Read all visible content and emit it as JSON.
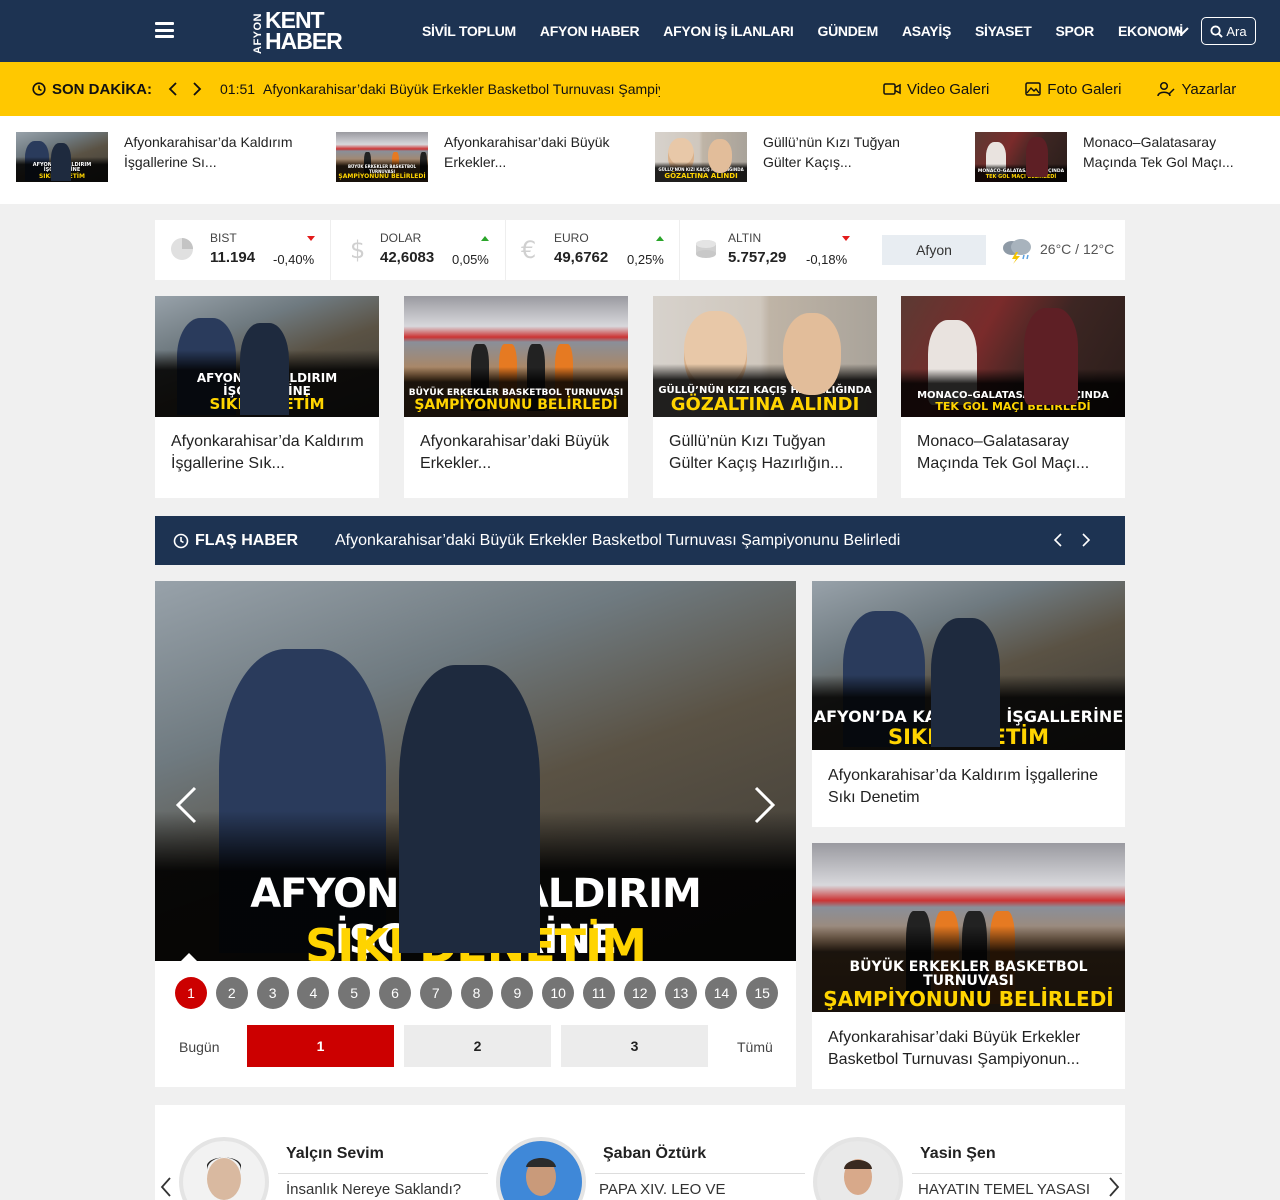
{
  "header": {
    "logo_side": "AFYON",
    "logo_top": "KENT",
    "logo_bottom": "HABER",
    "nav": [
      "SİVİL TOPLUM",
      "AFYON HABER",
      "AFYON İŞ İLANLARI",
      "GÜNDEM",
      "ASAYİŞ",
      "SİYASET",
      "SPOR",
      "EKONOMİ"
    ],
    "search_label": "Ara"
  },
  "breaking": {
    "label": "SON DAKİKA:",
    "time": "01:51",
    "text": "Afyonkarahisar’daki Büyük Erkekler Basketbol Turnuvası Şampiyonunu Belirledi",
    "links": [
      "Video Galeri",
      "Foto Galeri",
      "Yazarlar"
    ]
  },
  "strip": [
    {
      "title": "Afyonkarahisar’da Kaldırım İşgallerine Sı...",
      "cap1": "AFYON’DA KALDIRIM İŞGALLERİNE",
      "cap2": "SIKI DENETİM"
    },
    {
      "title": "Afyonkarahisar’daki Büyük Erkekler...",
      "cap1": "BÜYÜK ERKEKLER BASKETBOL TURNUVASI",
      "cap2": "ŞAMPİYONUNU BELİRLEDİ"
    },
    {
      "title": "Güllü’nün Kızı Tuğyan Gülter Kaçış...",
      "cap1": "GÜLLÜ’NÜN KIZI KAÇIŞ HAZIRLIĞINDA",
      "cap2": "GÖZALTINA ALINDI"
    },
    {
      "title": "Monaco–Galatasaray Maçında Tek Gol Maçı...",
      "cap1": "MONACO–GALATASARAY MAÇINDA",
      "cap2": "TEK GOL MAÇI BELİRLEDİ"
    }
  ],
  "market": [
    {
      "name": "BIST",
      "value": "11.194",
      "change": "-0,40%",
      "dir": "down",
      "icon": "pie-chart-icon"
    },
    {
      "name": "DOLAR",
      "value": "42,6083",
      "change": "0,05%",
      "dir": "up",
      "icon": "dollar-icon"
    },
    {
      "name": "EURO",
      "value": "49,6762",
      "change": "0,25%",
      "dir": "up",
      "icon": "euro-icon"
    },
    {
      "name": "ALTIN",
      "value": "5.757,29",
      "change": "-0,18%",
      "dir": "down",
      "icon": "coins-icon"
    }
  ],
  "weather": {
    "city": "Afyon",
    "temp": "26°C / 12°C",
    "icon": "storm-cloud-icon"
  },
  "cards": [
    {
      "title": "Afyonkarahisar’da Kaldırım İşgallerine Sık...",
      "cap1": "AFYON’DA KALDIRIM İŞGALLERİNE",
      "cap2": "SIKI DENETİM"
    },
    {
      "title": "Afyonkarahisar’daki Büyük Erkekler...",
      "cap1": "BÜYÜK ERKEKLER BASKETBOL TURNUVASI",
      "cap2": "ŞAMPİYONUNU BELİRLEDİ"
    },
    {
      "title": "Güllü’nün Kızı Tuğyan Gülter Kaçış Hazırlığın...",
      "cap1": "GÜLLÜ’NÜN KIZI KAÇIŞ HAZIRLIĞINDA",
      "cap2": "GÖZALTINA ALINDI"
    },
    {
      "title": "Monaco–Galatasaray Maçında Tek Gol Maçı...",
      "cap1": "MONACO–GALATASARAY MAÇINDA",
      "cap2": "TEK GOL MAÇI BELİRLEDİ"
    }
  ],
  "flash": {
    "label": "FLAŞ HABER",
    "text": "Afyonkarahisar’daki Büyük Erkekler Basketbol Turnuvası Şampiyonunu Belirledi"
  },
  "slider": {
    "cap1": "AFYON’DA KALDIRIM İŞGALLERİNE",
    "cap2": "SIKI DENETİM",
    "pages": [
      "1",
      "2",
      "3",
      "4",
      "5",
      "6",
      "7",
      "8",
      "9",
      "10",
      "11",
      "12",
      "13",
      "14",
      "15"
    ],
    "active_page": "1",
    "tab_left": "Bugün",
    "tabs": [
      "1",
      "2",
      "3"
    ],
    "tab_right": "Tümü"
  },
  "side": [
    {
      "title": "Afyonkarahisar’da Kaldırım İşgallerine Sıkı Denetim",
      "cap1": "AFYON’DA KALDIRIM İŞGALLERİNE",
      "cap2": "SIKI DENETİM"
    },
    {
      "title": "Afyonkarahisar’daki Büyük Erkekler Basketbol Turnuvası Şampiyonun...",
      "cap1": "BÜYÜK ERKEKLER BASKETBOL TURNUVASI",
      "cap2": "ŞAMPİYONUNU BELİRLEDİ"
    }
  ],
  "authors": [
    {
      "name": "Yalçın Sevim",
      "article": "İnsanlık Nereye Saklandı?"
    },
    {
      "name": "Şaban Öztürk",
      "article": "PAPA XIV. LEO VE"
    },
    {
      "name": "Yasin Şen",
      "article": "HAYATIN TEMEL YASASI"
    }
  ],
  "colors": {
    "navy": "#1d3352",
    "yellow": "#ffc800",
    "red": "#cc0000",
    "caption_yellow": "#ffd400"
  }
}
